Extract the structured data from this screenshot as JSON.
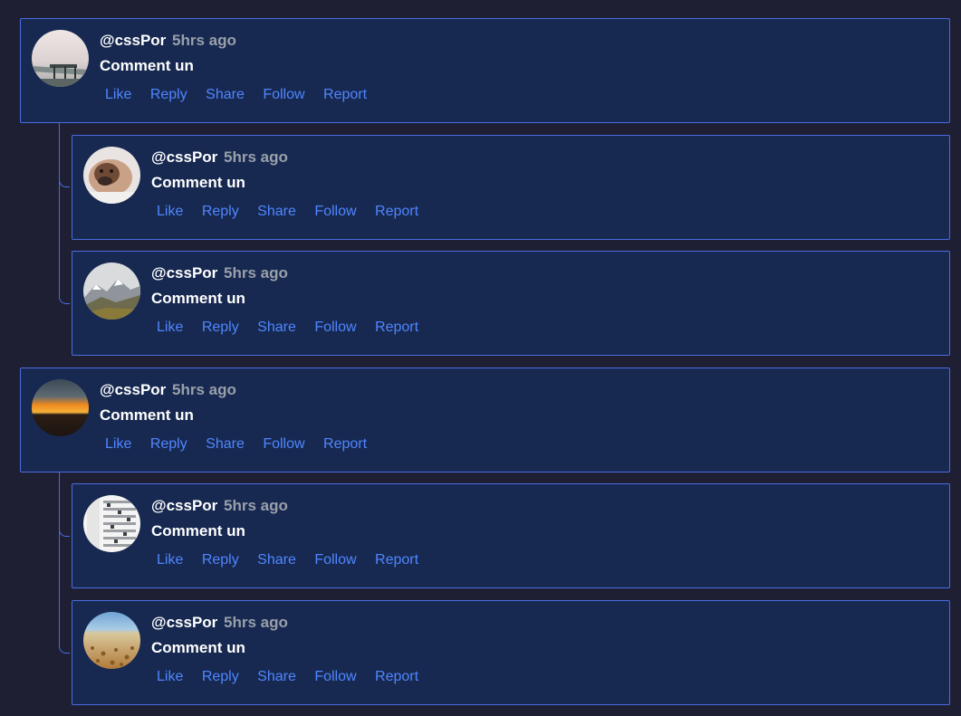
{
  "comments": [
    {
      "author": "@cssPor",
      "time": "5hrs ago",
      "body": "Comment un",
      "actions": [
        "Like",
        "Reply",
        "Share",
        "Follow",
        "Report"
      ]
    },
    {
      "author": "@cssPor",
      "time": "5hrs ago",
      "body": "Comment un",
      "actions": [
        "Like",
        "Reply",
        "Share",
        "Follow",
        "Report"
      ]
    },
    {
      "author": "@cssPor",
      "time": "5hrs ago",
      "body": "Comment un",
      "actions": [
        "Like",
        "Reply",
        "Share",
        "Follow",
        "Report"
      ]
    },
    {
      "author": "@cssPor",
      "time": "5hrs ago",
      "body": "Comment un",
      "actions": [
        "Like",
        "Reply",
        "Share",
        "Follow",
        "Report"
      ]
    },
    {
      "author": "@cssPor",
      "time": "5hrs ago",
      "body": "Comment un",
      "actions": [
        "Like",
        "Reply",
        "Share",
        "Follow",
        "Report"
      ]
    },
    {
      "author": "@cssPor",
      "time": "5hrs ago",
      "body": "Comment un",
      "actions": [
        "Like",
        "Reply",
        "Share",
        "Follow",
        "Report"
      ]
    }
  ],
  "colors": {
    "background": "#1f1f33",
    "card": "#172951",
    "border": "#4a6ce0",
    "link": "#4f86ff",
    "muted": "#9aa0aa",
    "text": "#ffffff"
  }
}
